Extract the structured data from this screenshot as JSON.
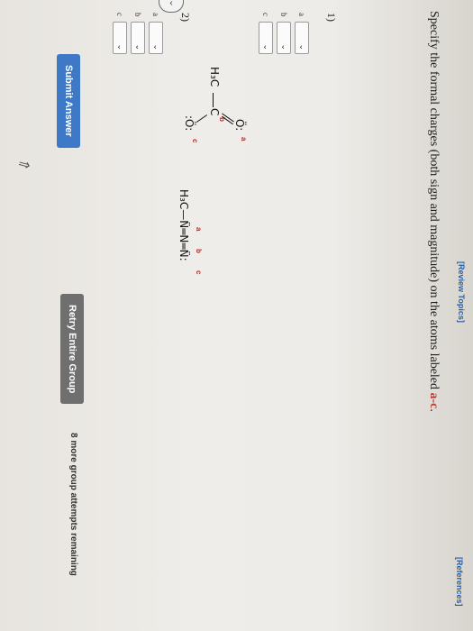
{
  "links": {
    "review_topics": "[Review Topics]",
    "references": "[References]"
  },
  "question": {
    "text": "Specify the formal charges (both sign and magnitude) on the atoms labeled ",
    "highlight": "a-c",
    "end": "."
  },
  "problems": [
    {
      "number": "1)",
      "structure": {
        "methyl": "H₃C",
        "central_atom": "C",
        "top_oxygen": "Ö:",
        "bottom_oxygen": ":Ö:",
        "labels": [
          "a",
          "b",
          "c"
        ]
      },
      "answers": [
        {
          "label": "a",
          "value": ""
        },
        {
          "label": "b",
          "value": ""
        },
        {
          "label": "c",
          "value": ""
        }
      ]
    },
    {
      "number": "2)",
      "structure": {
        "methyl": "H₃C",
        "chain": "N̈═N═N̈:",
        "labels": [
          "a",
          "b",
          "c"
        ]
      },
      "answers": [
        {
          "label": "a",
          "value": ""
        },
        {
          "label": "b",
          "value": ""
        },
        {
          "label": "c",
          "value": ""
        }
      ]
    }
  ],
  "buttons": {
    "submit": "Submit Answer",
    "retry": "Retry Entire Group"
  },
  "attempts_text": "8 more group attempts remaining",
  "icons": {
    "dropdown": "chevron-down-icon",
    "nav": "chevron-left-icon"
  }
}
